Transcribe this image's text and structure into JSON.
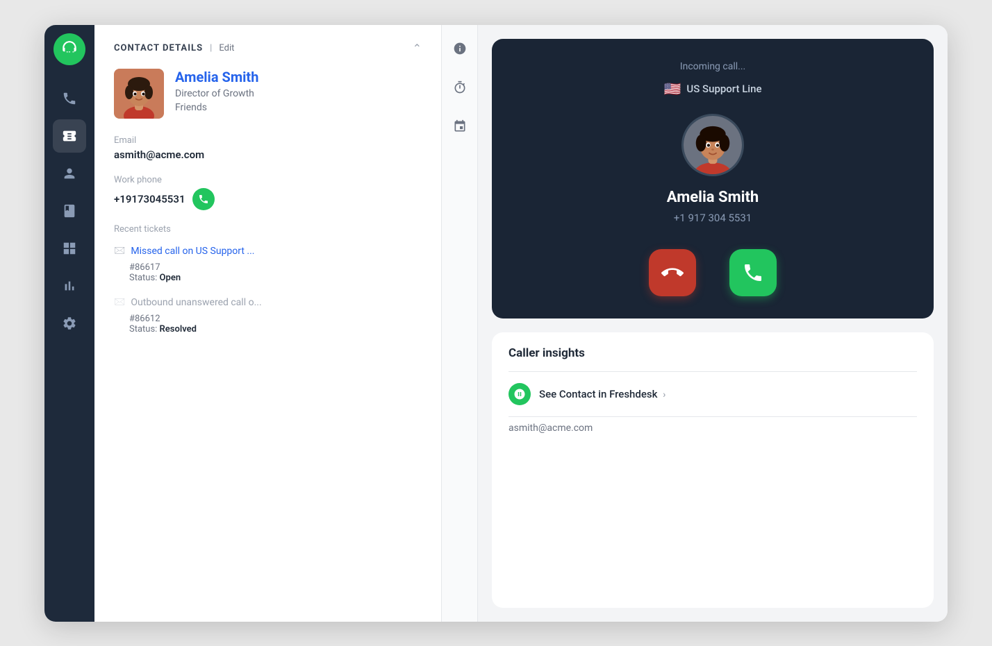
{
  "sidebar": {
    "logo_label": "Freshdesk",
    "nav_items": [
      {
        "id": "home",
        "icon": "home-icon",
        "active": false
      },
      {
        "id": "tickets",
        "icon": "ticket-icon",
        "active": true
      },
      {
        "id": "contacts",
        "icon": "contacts-icon",
        "active": false
      },
      {
        "id": "knowledge",
        "icon": "book-icon",
        "active": false
      },
      {
        "id": "reports",
        "icon": "reports-icon",
        "active": false
      },
      {
        "id": "analytics",
        "icon": "analytics-icon",
        "active": false
      },
      {
        "id": "settings",
        "icon": "settings-icon",
        "active": false
      }
    ]
  },
  "contact_panel": {
    "title": "CONTACT DETAILS",
    "divider": "|",
    "edit_label": "Edit",
    "contact": {
      "name": "Amelia Smith",
      "role": "Director of Growth",
      "company": "Friends",
      "email_label": "Email",
      "email": "asmith@acme.com",
      "work_phone_label": "Work phone",
      "work_phone": "+19173045531",
      "recent_tickets_label": "Recent tickets",
      "tickets": [
        {
          "title": "Missed call on US Support ...",
          "number": "#86617",
          "status_label": "Status:",
          "status": "Open",
          "active": true
        },
        {
          "title": "Outbound unanswered call o...",
          "number": "#86612",
          "status_label": "Status:",
          "status": "Resolved",
          "active": false
        }
      ]
    }
  },
  "tools": [
    {
      "id": "info",
      "icon": "info-icon"
    },
    {
      "id": "timer",
      "icon": "timer-icon"
    },
    {
      "id": "calendar",
      "icon": "calendar-icon"
    }
  ],
  "call_card": {
    "incoming_text": "Incoming call...",
    "flag_emoji": "🇺🇸",
    "support_line": "US Support Line",
    "caller_name": "Amelia Smith",
    "caller_phone": "+1 917 304 5531",
    "reject_label": "Reject",
    "accept_label": "Accept"
  },
  "caller_insights": {
    "title": "Caller insights",
    "see_contact_label": "See Contact in Freshdesk",
    "see_contact_chevron": "›",
    "contact_email": "asmith@acme.com"
  },
  "colors": {
    "green": "#22c55e",
    "red": "#c0392b",
    "dark_bg": "#1a2535",
    "sidebar_bg": "#1e2a3b",
    "blue_name": "#2563eb"
  }
}
